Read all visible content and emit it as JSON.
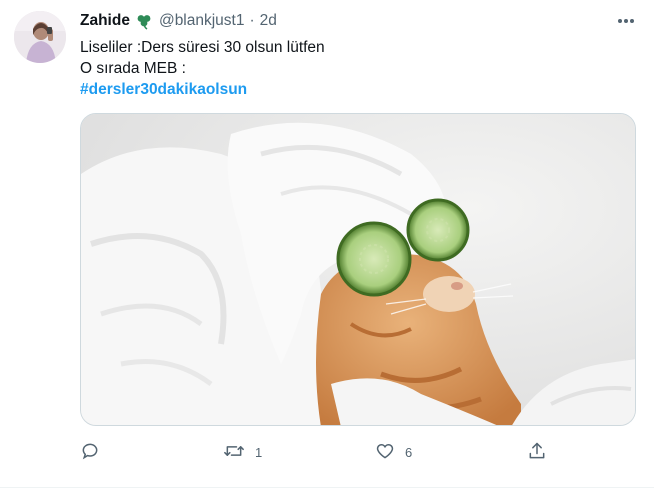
{
  "tweet": {
    "author_name": "Zahide",
    "author_emoji_icon": "shamrock-icon",
    "author_handle": "@blankjust1",
    "separator": "·",
    "time": "2d",
    "lines": [
      "Liseliler :Ders süresi 30 olsun lütfen",
      "O sırada MEB :"
    ],
    "hashtag": "#dersler30dakikaolsun",
    "media_alt": "cat relaxing in towel with cucumber slices on eyes"
  },
  "actions": {
    "reply_count": "",
    "retweet_count": "1",
    "like_count": "6",
    "share_count": ""
  },
  "colors": {
    "text": "#0f1419",
    "secondary": "#536471",
    "link": "#1d9bf0",
    "clover": "#2e8b57"
  }
}
